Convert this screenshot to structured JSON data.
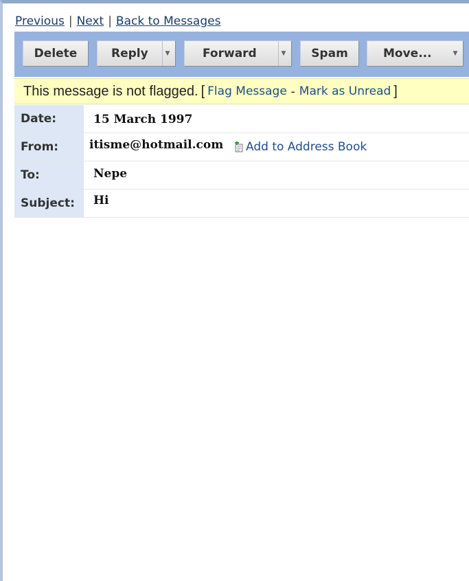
{
  "nav": {
    "previous": "Previous",
    "separator": "|",
    "next": "Next",
    "back": "Back to Messages"
  },
  "toolbar": {
    "delete": "Delete",
    "reply": "Reply",
    "forward": "Forward",
    "spam": "Spam",
    "move": "Move..."
  },
  "flag": {
    "status": "This message is not flagged.",
    "open_bracket": "[",
    "flag_link": "Flag Message",
    "dash": "-",
    "unread_link": "Mark as Unread",
    "close_bracket": "]"
  },
  "headers": {
    "date_label": "Date:",
    "date_value": "15 March 1997",
    "from_label": "From:",
    "from_value": "itisme@hotmail.com",
    "add_address": "Add to Address Book",
    "to_label": "To:",
    "to_value": "Nepe",
    "subject_label": "Subject:",
    "subject_value": "Hi"
  },
  "colors": {
    "toolbar_bg": "#96b2de",
    "flag_bg": "#ffffc2",
    "label_bg": "#dde7f5",
    "link": "#1f4d8c"
  },
  "icons": {
    "add_address": "address-book-add-icon",
    "dropdown": "caret-down-icon"
  }
}
